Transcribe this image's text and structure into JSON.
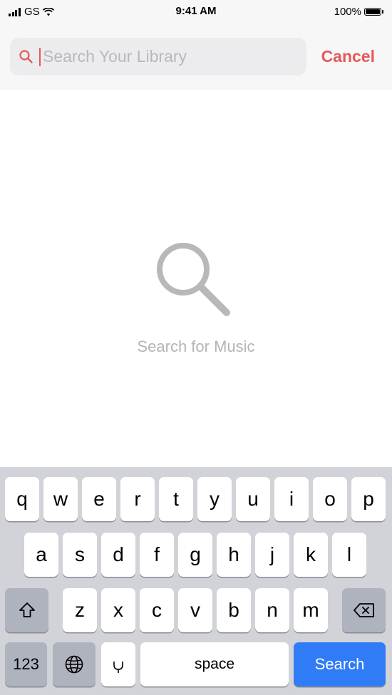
{
  "status_bar": {
    "carrier": "GS",
    "time": "9:41 AM",
    "battery": "100%"
  },
  "search": {
    "placeholder": "Search Your Library",
    "value": "",
    "cancel_label": "Cancel"
  },
  "empty_state": {
    "message": "Search for Music"
  },
  "keyboard": {
    "row1": [
      "q",
      "w",
      "e",
      "r",
      "t",
      "y",
      "u",
      "i",
      "o",
      "p"
    ],
    "row2": [
      "a",
      "s",
      "d",
      "f",
      "g",
      "h",
      "j",
      "k",
      "l"
    ],
    "row3": [
      "z",
      "x",
      "c",
      "v",
      "b",
      "n",
      "m"
    ],
    "numbers_label": "123",
    "space_label": "space",
    "search_label": "Search"
  },
  "colors": {
    "accent": "#e35a5a",
    "search_key": "#2f7cf6",
    "keyboard_bg": "#d1d3d9"
  }
}
